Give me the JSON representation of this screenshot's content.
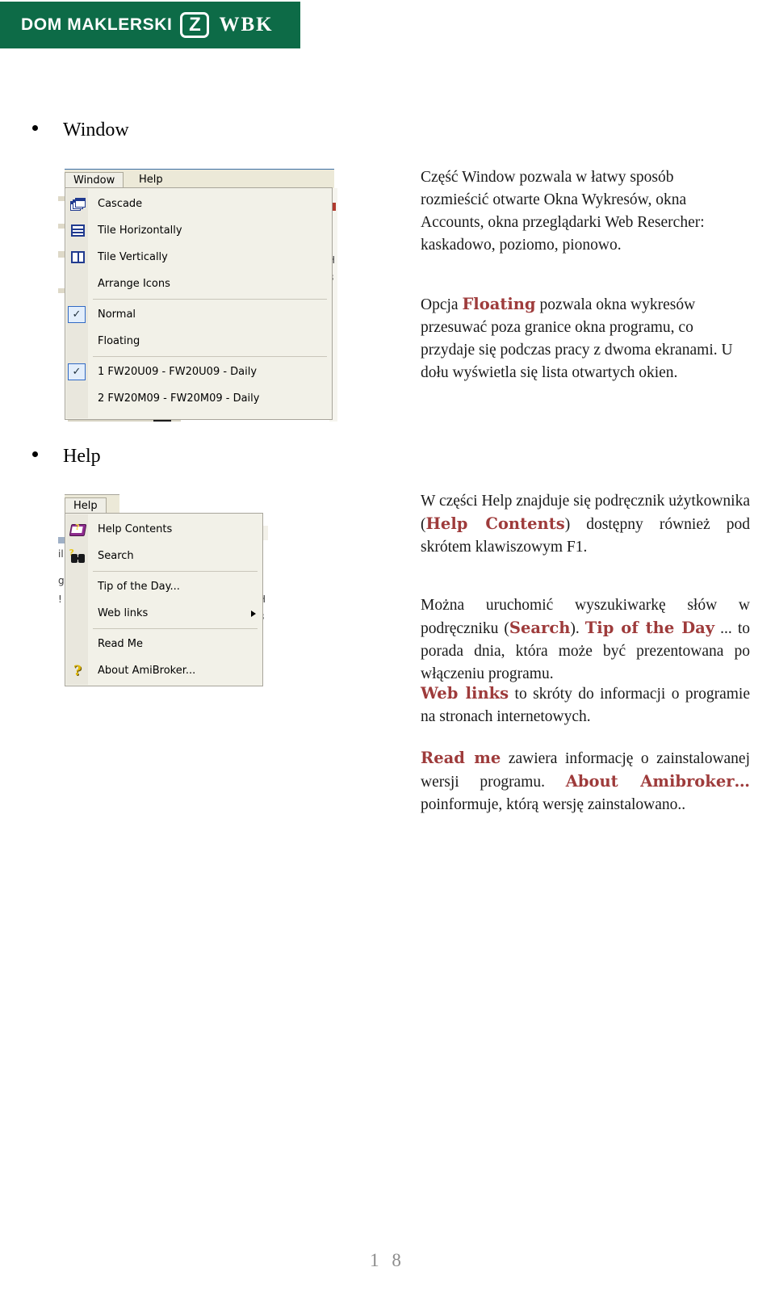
{
  "header": {
    "brand_text": "DOM MAKLERSKI",
    "brand_mark": "Z",
    "brand_wbk": "WBK",
    "brand_color": "#0d6b47"
  },
  "sections": [
    {
      "id": "window",
      "heading": "Window"
    },
    {
      "id": "help",
      "heading": "Help"
    }
  ],
  "window_menu": {
    "menubar": [
      {
        "label": "Window",
        "active": true
      },
      {
        "label": "Help",
        "active": false
      }
    ],
    "items": [
      {
        "label": "Cascade",
        "icon": "cascade-icon",
        "accel": "C"
      },
      {
        "label": "Tile Horizontally",
        "icon": "tile-horizontally-icon",
        "accel": "T"
      },
      {
        "label": "Tile Vertically",
        "icon": "tile-vertically-icon",
        "accel": "V"
      },
      {
        "label": "Arrange Icons",
        "icon": "",
        "accel": "A"
      },
      {
        "separator": true
      },
      {
        "label": "Normal",
        "checked": true
      },
      {
        "label": "Floating",
        "checked": false
      },
      {
        "separator": true
      },
      {
        "label": "1 FW20U09 - FW20U09 - Daily",
        "checked": true
      },
      {
        "label": "2 FW20M09 - FW20M09 - Daily",
        "checked": false
      }
    ]
  },
  "help_menu": {
    "menubar": [
      {
        "label": "Help",
        "active": true
      }
    ],
    "items": [
      {
        "label": "Help Contents",
        "icon": "help-book-icon"
      },
      {
        "label": "Search",
        "icon": "binoculars-icon"
      },
      {
        "separator": true
      },
      {
        "label": "Tip of the Day..."
      },
      {
        "label": "Web links",
        "submenu": true
      },
      {
        "separator": true
      },
      {
        "label": "Read Me"
      },
      {
        "label": "About AmiBroker...",
        "icon": "question-mark-icon"
      }
    ]
  },
  "window_text": {
    "p1": "Część Window pozwala w łatwy sposób rozmieścić otwarte Okna Wykresów, okna Accounts, okna przeglądarki Web Resercher: kaskadowo, poziomo, pionowo.",
    "p2_pre": "Opcja ",
    "p2_kw": "Floating",
    "p2_post": " pozwala okna wykresów przesuwać poza granice okna programu, co przydaje się podczas pracy z dwoma ekranami. U dołu wyświetla się lista otwartych okien."
  },
  "help_text": {
    "p1_a": "W części Help znajduje się podręcznik użytkownika (",
    "p1_kw": "Help Contents",
    "p1_b": ") dostępny również pod skrótem klawiszowym F1.",
    "p2_a": "Można uruchomić wyszukiwarkę słów w podręczniku (",
    "p2_kw1": "Search",
    "p2_b": "). ",
    "p2_kw2": "Tip of the Day",
    "p2_c": " ... to porada dnia, która może być prezentowana po włączeniu programu.",
    "p3_kw": "Web links",
    "p3_rest": " to skróty do informacji o programie na stronach internetowych.",
    "p4_kw1": "Read me",
    "p4_a": " zawiera informację o zainstalowanej wersji programu. ",
    "p4_kw2": "About Amibroker…",
    "p4_b": " poinformuje, którą wersję zainstalowano.."
  },
  "footer": {
    "page_number": "1 8"
  }
}
